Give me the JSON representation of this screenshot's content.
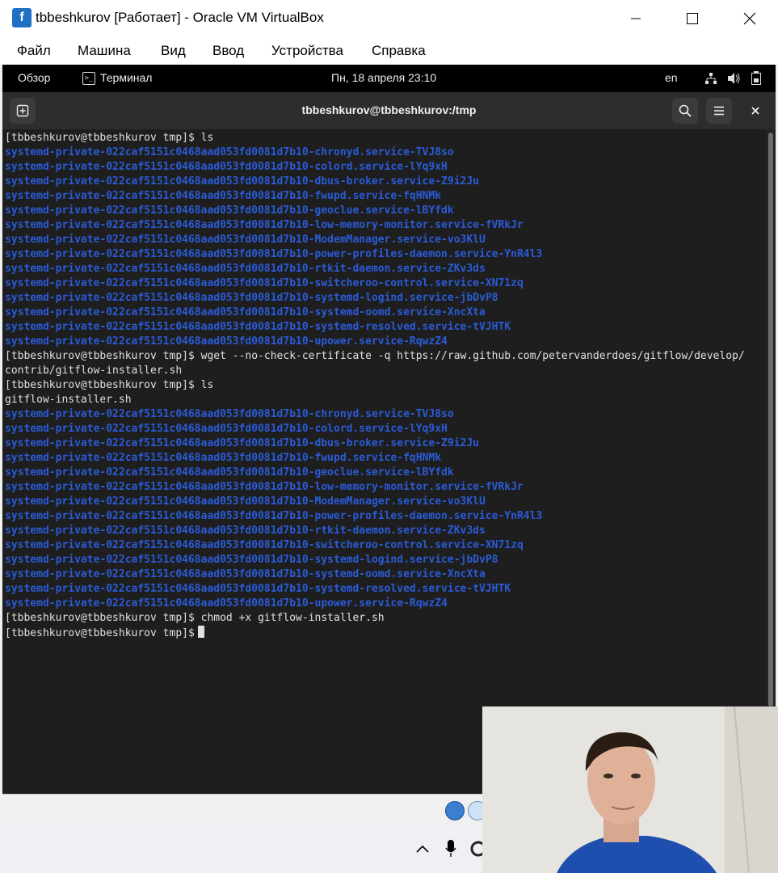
{
  "window": {
    "title": "tbbeshkurov [Работает] - Oracle VM VirtualBox",
    "app_icon": "virtualbox-icon"
  },
  "menubar": {
    "items": [
      "Файл",
      "Машина",
      "Вид",
      "Ввод",
      "Устройства",
      "Справка"
    ]
  },
  "gnome_bar": {
    "overview": "Обзор",
    "app_name": "Терминал",
    "clock": "Пн, 18 апреля  23:10",
    "lang": "en"
  },
  "terminal": {
    "title": "tbbeshkurov@tbbeshkurov:/tmp",
    "lines": [
      {
        "text": "[tbbeshkurov@tbbeshkurov tmp]$ ls",
        "kind": "cmd"
      },
      {
        "text": "systemd-private-022caf5151c0468aad053fd0081d7b10-chronyd.service-TVJ8so",
        "kind": "dir"
      },
      {
        "text": "systemd-private-022caf5151c0468aad053fd0081d7b10-colord.service-lYq9xH",
        "kind": "dir"
      },
      {
        "text": "systemd-private-022caf5151c0468aad053fd0081d7b10-dbus-broker.service-Z9i2Ju",
        "kind": "dir"
      },
      {
        "text": "systemd-private-022caf5151c0468aad053fd0081d7b10-fwupd.service-fqHNMk",
        "kind": "dir"
      },
      {
        "text": "systemd-private-022caf5151c0468aad053fd0081d7b10-geoclue.service-lBYfdk",
        "kind": "dir"
      },
      {
        "text": "systemd-private-022caf5151c0468aad053fd0081d7b10-low-memory-monitor.service-fVRkJr",
        "kind": "dir"
      },
      {
        "text": "systemd-private-022caf5151c0468aad053fd0081d7b10-ModemManager.service-vo3KlU",
        "kind": "dir"
      },
      {
        "text": "systemd-private-022caf5151c0468aad053fd0081d7b10-power-profiles-daemon.service-YnR4l3",
        "kind": "dir"
      },
      {
        "text": "systemd-private-022caf5151c0468aad053fd0081d7b10-rtkit-daemon.service-ZKv3ds",
        "kind": "dir"
      },
      {
        "text": "systemd-private-022caf5151c0468aad053fd0081d7b10-switcheroo-control.service-XN71zq",
        "kind": "dir"
      },
      {
        "text": "systemd-private-022caf5151c0468aad053fd0081d7b10-systemd-logind.service-jbDvP8",
        "kind": "dir"
      },
      {
        "text": "systemd-private-022caf5151c0468aad053fd0081d7b10-systemd-oomd.service-XncXta",
        "kind": "dir"
      },
      {
        "text": "systemd-private-022caf5151c0468aad053fd0081d7b10-systemd-resolved.service-tVJHTK",
        "kind": "dir"
      },
      {
        "text": "systemd-private-022caf5151c0468aad053fd0081d7b10-upower.service-RqwzZ4",
        "kind": "dir"
      },
      {
        "text": "[tbbeshkurov@tbbeshkurov tmp]$ wget --no-check-certificate -q https://raw.github.com/petervanderdoes/gitflow/develop/",
        "kind": "cmd"
      },
      {
        "text": "contrib/gitflow-installer.sh",
        "kind": "cmd"
      },
      {
        "text": "[tbbeshkurov@tbbeshkurov tmp]$ ls",
        "kind": "cmd"
      },
      {
        "text": "gitflow-installer.sh",
        "kind": "file"
      },
      {
        "text": "systemd-private-022caf5151c0468aad053fd0081d7b10-chronyd.service-TVJ8so",
        "kind": "dir"
      },
      {
        "text": "systemd-private-022caf5151c0468aad053fd0081d7b10-colord.service-lYq9xH",
        "kind": "dir"
      },
      {
        "text": "systemd-private-022caf5151c0468aad053fd0081d7b10-dbus-broker.service-Z9i2Ju",
        "kind": "dir"
      },
      {
        "text": "systemd-private-022caf5151c0468aad053fd0081d7b10-fwupd.service-fqHNMk",
        "kind": "dir"
      },
      {
        "text": "systemd-private-022caf5151c0468aad053fd0081d7b10-geoclue.service-lBYfdk",
        "kind": "dir"
      },
      {
        "text": "systemd-private-022caf5151c0468aad053fd0081d7b10-low-memory-monitor.service-fVRkJr",
        "kind": "dir"
      },
      {
        "text": "systemd-private-022caf5151c0468aad053fd0081d7b10-ModemManager.service-vo3KlU",
        "kind": "dir"
      },
      {
        "text": "systemd-private-022caf5151c0468aad053fd0081d7b10-power-profiles-daemon.service-YnR4l3",
        "kind": "dir"
      },
      {
        "text": "systemd-private-022caf5151c0468aad053fd0081d7b10-rtkit-daemon.service-ZKv3ds",
        "kind": "dir"
      },
      {
        "text": "systemd-private-022caf5151c0468aad053fd0081d7b10-switcheroo-control.service-XN71zq",
        "kind": "dir"
      },
      {
        "text": "systemd-private-022caf5151c0468aad053fd0081d7b10-systemd-logind.service-jbDvP8",
        "kind": "dir"
      },
      {
        "text": "systemd-private-022caf5151c0468aad053fd0081d7b10-systemd-oomd.service-XncXta",
        "kind": "dir"
      },
      {
        "text": "systemd-private-022caf5151c0468aad053fd0081d7b10-systemd-resolved.service-tVJHTK",
        "kind": "dir"
      },
      {
        "text": "systemd-private-022caf5151c0468aad053fd0081d7b10-upower.service-RqwzZ4",
        "kind": "dir"
      },
      {
        "text": "[tbbeshkurov@tbbeshkurov tmp]$ chmod +x gitflow-installer.sh",
        "kind": "cmd"
      },
      {
        "text": "[tbbeshkurov@tbbeshkurov tmp]$",
        "kind": "cmd"
      }
    ]
  },
  "colors": {
    "dir_text": "#2a5bd7",
    "terminal_bg": "#1e1e1e",
    "terminal_fg": "#e0e0e0"
  }
}
